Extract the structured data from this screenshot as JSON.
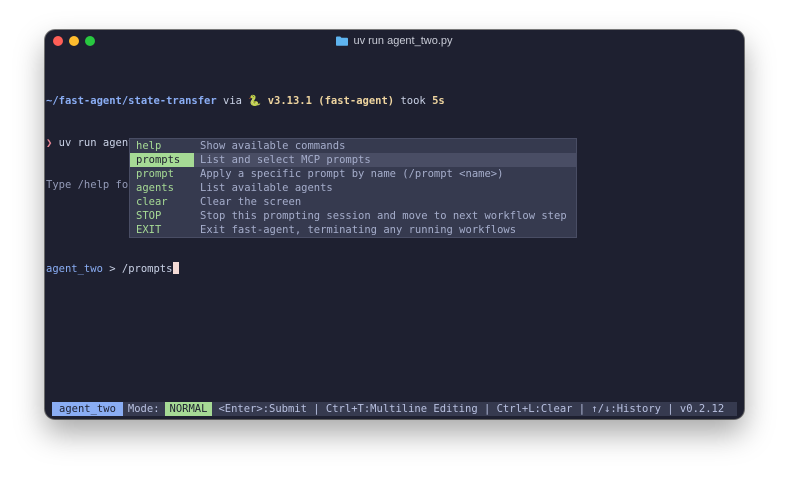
{
  "window": {
    "title": "uv run agent_two.py",
    "title_icon": "folder-icon"
  },
  "terminal": {
    "line1": {
      "path": "~/fast-agent/state-transfer",
      "via": " via ",
      "python_icon": "🐍",
      "version": " v3.13.1 (fast-agent)",
      "took": " took ",
      "duration": "5s"
    },
    "line2": {
      "symbol": "❯",
      "command": " uv run agent_two.py"
    },
    "help_text": "Type /help for commands, @agent to switch agent. Ctrl+T toggles multiline mode.",
    "prompt": {
      "agent": "agent_two",
      "separator": " > ",
      "input": "/prompts"
    }
  },
  "completion": {
    "items": [
      {
        "cmd": "help",
        "desc": "Show available commands"
      },
      {
        "cmd": "prompts",
        "desc": "List and select MCP prompts"
      },
      {
        "cmd": "prompt",
        "desc": "Apply a specific prompt by name (/prompt <name>)"
      },
      {
        "cmd": "agents",
        "desc": "List available agents"
      },
      {
        "cmd": "clear",
        "desc": "Clear the screen"
      },
      {
        "cmd": "STOP",
        "desc": "Stop this prompting session and move to next workflow step"
      },
      {
        "cmd": "EXIT",
        "desc": "Exit fast-agent, terminating any running workflows"
      }
    ],
    "selected": "prompts"
  },
  "statusbar": {
    "agent": "agent_two",
    "mode_label": "Mode:",
    "mode": "NORMAL",
    "hints": "<Enter>:Submit | Ctrl+T:Multiline Editing | Ctrl+L:Clear | ↑/↓:History | v0.2.12"
  },
  "colors": {
    "background": "#1e2030",
    "accent": "#8aadf4",
    "command": "#a6da95"
  }
}
